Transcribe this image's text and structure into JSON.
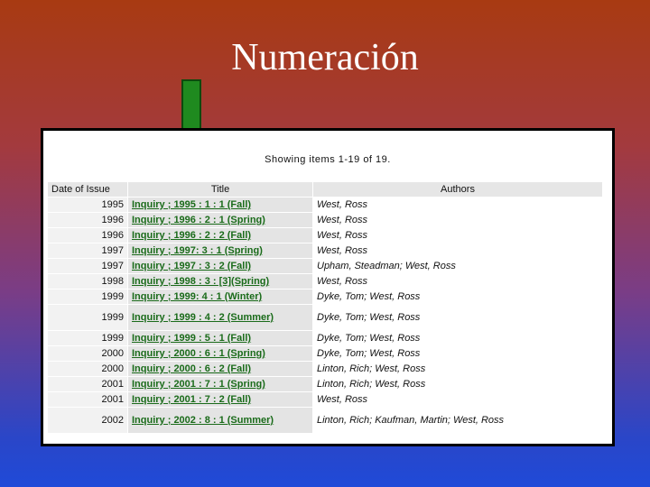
{
  "slide": {
    "title": "Numeración"
  },
  "results": {
    "summary": "Showing items 1-19 of 19.",
    "headers": {
      "date": "Date of Issue",
      "title": "Title",
      "authors": "Authors"
    },
    "rows": [
      {
        "date": "1995",
        "title": "Inquiry ; 1995 : 1 : 1 (Fall)",
        "authors": "West, Ross"
      },
      {
        "date": "1996",
        "title": "Inquiry ; 1996 : 2 : 1 (Spring)",
        "authors": "West, Ross"
      },
      {
        "date": "1996",
        "title": "Inquiry ; 1996 : 2 : 2 (Fall)",
        "authors": "West, Ross"
      },
      {
        "date": "1997",
        "title": "Inquiry ; 1997: 3 : 1 (Spring)",
        "authors": "West, Ross"
      },
      {
        "date": "1997",
        "title": "Inquiry ; 1997 : 3 : 2 (Fall)",
        "authors": "Upham, Steadman; West, Ross"
      },
      {
        "date": "1998",
        "title": "Inquiry ; 1998 : 3 : [3](Spring)",
        "authors": "West, Ross"
      },
      {
        "date": "1999",
        "title": "Inquiry ; 1999: 4 : 1 (Winter)",
        "authors": "Dyke, Tom; West, Ross"
      },
      {
        "date": "1999",
        "title": "Inquiry ; 1999 : 4 : 2 (Summer)",
        "authors": "Dyke, Tom; West, Ross",
        "tall": true
      },
      {
        "date": "1999",
        "title": "Inquiry ; 1999 : 5 : 1 (Fall)",
        "authors": "Dyke, Tom; West, Ross"
      },
      {
        "date": "2000",
        "title": "Inquiry ; 2000 : 6 : 1 (Spring)",
        "authors": "Dyke, Tom; West, Ross"
      },
      {
        "date": "2000",
        "title": "Inquiry ; 2000 : 6 : 2 (Fall)",
        "authors": "Linton, Rich; West, Ross"
      },
      {
        "date": "2001",
        "title": "Inquiry ; 2001 : 7 : 1 (Spring)",
        "authors": "Linton, Rich; West, Ross"
      },
      {
        "date": "2001",
        "title": "Inquiry ; 2001 : 7 : 2 (Fall)",
        "authors": "West, Ross"
      },
      {
        "date": "2002",
        "title": "Inquiry ; 2002 : 8 : 1 (Summer)",
        "authors": "Linton, Rich; Kaufman, Martin; West, Ross",
        "tall": true
      }
    ]
  },
  "colors": {
    "arrow": "#1f8a1f",
    "link": "#1a6b1a"
  },
  "icons": {
    "pointer": "down-arrow-icon"
  }
}
